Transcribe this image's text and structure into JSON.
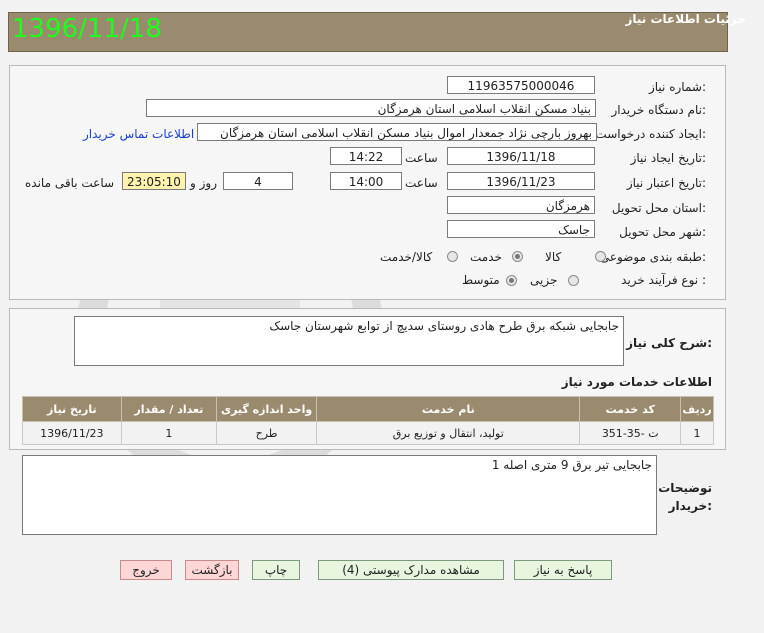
{
  "header": {
    "title": "جزئیات اطلاعات نیاز",
    "date_big": "1396/11/18"
  },
  "form": {
    "need_number_label": "شماره نیاز:",
    "need_number": "1196357500004‌6",
    "buyer_org_label": "نام دستگاه خریدار:",
    "buyer_org": "بنیاد مسکن انقلاب اسلامی استان هرمزگان",
    "requester_label": "ایجاد کننده درخواست:",
    "requester": "بهروز  بارچی نژاد جمعدار اموال بنیاد مسکن انقلاب اسلامی استان هرمزگان",
    "contact_link": "اطلاعات تماس خریدار",
    "created_label": "تاریخ ایجاد نیاز:",
    "created_date": "1396/11/18",
    "time_label": "ساعت",
    "created_time": "14:22",
    "validity_label": "تاریخ اعتبار نیاز:",
    "validity_date": "1396/11/23",
    "validity_time": "14:00",
    "days_value": "4",
    "days_label": "روز و",
    "remaining_time": "23:05:10",
    "remaining_label": "ساعت باقی مانده",
    "province_label": "استان محل تحویل:",
    "province": "هرمزگان",
    "city_label": "شهر محل تحویل:",
    "city": "جاسک",
    "category_label": "طبقه بندی موضوعی:",
    "category_options": [
      "کالا",
      "خدمت",
      "کالا/خدمت"
    ],
    "process_label": "نوع فرآیند خرید :",
    "process_options": [
      "جزیی",
      "متوسط"
    ]
  },
  "summary": {
    "label": "شرح کلی نیاز:",
    "text": "جابجایی شبکه برق طرح هادی روستای سدیچ از توابع شهرستان جاسک"
  },
  "services": {
    "title": "اطلاعات خدمات مورد نیاز",
    "columns": [
      "ردیف",
      "کد خدمت",
      "نام خدمت",
      "واحد اندازه گیری",
      "تعداد / مقدار",
      "تاریخ نیاز"
    ],
    "rows": [
      [
        "1",
        "ت -35-351",
        "تولید، انتقال و توزیع برق",
        "طرح",
        "1",
        "1396/11/23"
      ]
    ]
  },
  "notes": {
    "label_line1": "توضیحات",
    "label_line2": "خریدار:",
    "text": "جابجایی تیر برق 9 متری  اصله  1"
  },
  "buttons": {
    "reply": "پاسخ به نیاز",
    "attachments": "مشاهده مدارک پیوستی (4)",
    "print": "چاپ",
    "back": "بازگشت",
    "exit": "خروج"
  }
}
